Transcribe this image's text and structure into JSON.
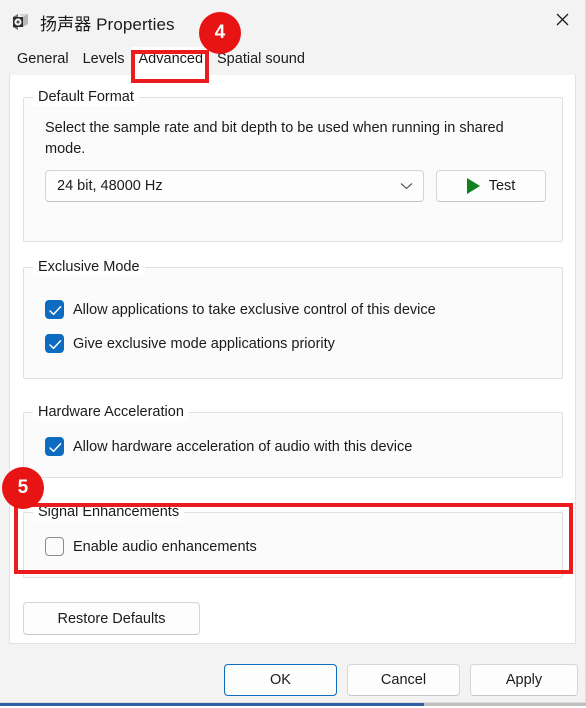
{
  "window": {
    "title": "扬声器 Properties",
    "icon": "speaker-icon",
    "close_label": "✕"
  },
  "tabs": [
    {
      "label": "General",
      "selected": false
    },
    {
      "label": "Levels",
      "selected": false
    },
    {
      "label": "Advanced",
      "selected": true
    },
    {
      "label": "Spatial sound",
      "selected": false
    }
  ],
  "groups": {
    "default_format": {
      "legend": "Default Format",
      "description": "Select the sample rate and bit depth to be used when running in shared mode.",
      "combo_value": "24 bit, 48000 Hz",
      "combo_chevron": "chevron-down-icon",
      "test_button": "Test"
    },
    "exclusive_mode": {
      "legend": "Exclusive Mode",
      "checkboxes": [
        {
          "label": "Allow applications to take exclusive control of this device",
          "checked": true
        },
        {
          "label": "Give exclusive mode applications priority",
          "checked": true
        }
      ]
    },
    "hardware_acceleration": {
      "legend": "Hardware Acceleration",
      "checkboxes": [
        {
          "label": "Allow hardware acceleration of audio with this device",
          "checked": true
        }
      ]
    },
    "signal_enhancements": {
      "legend": "Signal Enhancements",
      "checkboxes": [
        {
          "label": "Enable audio enhancements",
          "checked": false
        }
      ]
    }
  },
  "buttons": {
    "restore_defaults": "Restore Defaults",
    "ok": "OK",
    "cancel": "Cancel",
    "apply": "Apply"
  },
  "annotations": {
    "badge_4": "4",
    "badge_5": "5",
    "highlight_color": "#ec1c1c",
    "badge_color": "#e81313"
  },
  "colors": {
    "accent": "#0d6cc0",
    "default_button_border": "#0f6cbd",
    "play_green": "#10801f"
  }
}
